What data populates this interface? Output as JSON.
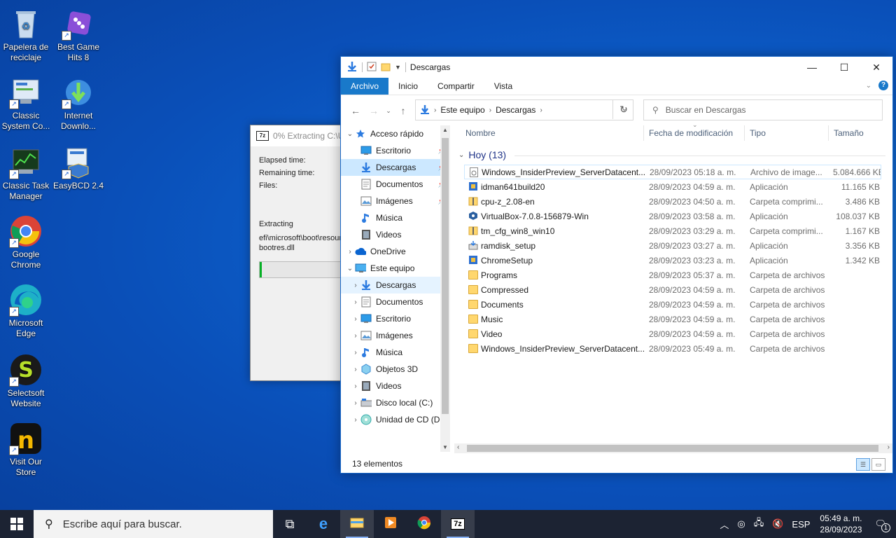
{
  "desktop": {
    "icons": [
      {
        "label": "Papelera de reciclaje",
        "icon": "recycle-bin-icon"
      },
      {
        "label": "Best Game Hits 8",
        "icon": "dice-icon"
      },
      {
        "label": "Classic System Co...",
        "icon": "control-panel-icon"
      },
      {
        "label": "Internet Downlo...",
        "icon": "idm-icon"
      },
      {
        "label": "Classic Task Manager",
        "icon": "task-manager-icon"
      },
      {
        "label": "EasyBCD 2.4",
        "icon": "easybcd-icon"
      },
      {
        "label": "Google Chrome",
        "icon": "chrome-icon"
      },
      {
        "label": "Microsoft Edge",
        "icon": "edge-icon"
      },
      {
        "label": "Selectsoft Website",
        "icon": "selectsoft-icon"
      },
      {
        "label": "Visit Our Store",
        "icon": "store-icon"
      }
    ]
  },
  "zip_dialog": {
    "title": "0% Extracting C:\\U",
    "elapsed_label": "Elapsed time:",
    "remaining_label": "Remaining time:",
    "files_label": "Files:",
    "extracting_label": "Extracting",
    "path_line": "efi\\microsoft\\boot\\resour",
    "file_line": "bootres.dll",
    "progress": 0.02
  },
  "explorer": {
    "title": "Descargas",
    "ribbon_tabs": [
      "Archivo",
      "Inicio",
      "Compartir",
      "Vista"
    ],
    "address": [
      "Este equipo",
      "Descargas"
    ],
    "search_placeholder": "Buscar en Descargas",
    "nav": [
      {
        "label": "Acceso rápido",
        "level": 0,
        "expanded": true
      },
      {
        "label": "Escritorio",
        "level": 1,
        "pinned": true
      },
      {
        "label": "Descargas",
        "level": 1,
        "pinned": true,
        "selected": true
      },
      {
        "label": "Documentos",
        "level": 1,
        "pinned": true
      },
      {
        "label": "Imágenes",
        "level": 1,
        "pinned": true
      },
      {
        "label": "Música",
        "level": 1
      },
      {
        "label": "Videos",
        "level": 1
      },
      {
        "label": "OneDrive",
        "level": 0
      },
      {
        "label": "Este equipo",
        "level": 0,
        "expanded": true
      },
      {
        "label": "Descargas",
        "level": 1,
        "hover": true
      },
      {
        "label": "Documentos",
        "level": 1
      },
      {
        "label": "Escritorio",
        "level": 1
      },
      {
        "label": "Imágenes",
        "level": 1
      },
      {
        "label": "Música",
        "level": 1
      },
      {
        "label": "Objetos 3D",
        "level": 1
      },
      {
        "label": "Videos",
        "level": 1
      },
      {
        "label": "Disco local (C:)",
        "level": 1
      },
      {
        "label": "Unidad de CD (D",
        "level": 1
      }
    ],
    "columns": {
      "name": "Nombre",
      "date": "Fecha de modificación",
      "type": "Tipo",
      "size": "Tamaño"
    },
    "group_label": "Hoy (13)",
    "files": [
      {
        "name": "Windows_InsiderPreview_ServerDatacent...",
        "date": "28/09/2023 05:18 a. m.",
        "type": "Archivo de image...",
        "size": "5.084.666 KB",
        "icon": "disc-image-icon",
        "selected": true
      },
      {
        "name": "idman641build20",
        "date": "28/09/2023 04:59 a. m.",
        "type": "Aplicación",
        "size": "11.165 KB",
        "icon": "app-icon"
      },
      {
        "name": "cpu-z_2.08-en",
        "date": "28/09/2023 04:50 a. m.",
        "type": "Carpeta comprimi...",
        "size": "3.486 KB",
        "icon": "zip-folder-icon"
      },
      {
        "name": "VirtualBox-7.0.8-156879-Win",
        "date": "28/09/2023 03:58 a. m.",
        "type": "Aplicación",
        "size": "108.037 KB",
        "icon": "virtualbox-icon"
      },
      {
        "name": "tm_cfg_win8_win10",
        "date": "28/09/2023 03:29 a. m.",
        "type": "Carpeta comprimi...",
        "size": "1.167 KB",
        "icon": "zip-folder-icon"
      },
      {
        "name": "ramdisk_setup",
        "date": "28/09/2023 03:27 a. m.",
        "type": "Aplicación",
        "size": "3.356 KB",
        "icon": "installer-icon"
      },
      {
        "name": "ChromeSetup",
        "date": "28/09/2023 03:23 a. m.",
        "type": "Aplicación",
        "size": "1.342 KB",
        "icon": "app-icon"
      },
      {
        "name": "Programs",
        "date": "28/09/2023 05:37 a. m.",
        "type": "Carpeta de archivos",
        "size": "",
        "icon": "folder-icon"
      },
      {
        "name": "Compressed",
        "date": "28/09/2023 04:59 a. m.",
        "type": "Carpeta de archivos",
        "size": "",
        "icon": "folder-icon"
      },
      {
        "name": "Documents",
        "date": "28/09/2023 04:59 a. m.",
        "type": "Carpeta de archivos",
        "size": "",
        "icon": "folder-icon"
      },
      {
        "name": "Music",
        "date": "28/09/2023 04:59 a. m.",
        "type": "Carpeta de archivos",
        "size": "",
        "icon": "folder-icon"
      },
      {
        "name": "Video",
        "date": "28/09/2023 04:59 a. m.",
        "type": "Carpeta de archivos",
        "size": "",
        "icon": "folder-icon"
      },
      {
        "name": "Windows_InsiderPreview_ServerDatacent...",
        "date": "28/09/2023 05:49 a. m.",
        "type": "Carpeta de archivos",
        "size": "",
        "icon": "folder-icon"
      }
    ],
    "status": "13 elementos"
  },
  "taskbar": {
    "search_placeholder": "Escribe aquí para buscar.",
    "language": "ESP",
    "time": "05:49 a. m.",
    "date": "28/09/2023",
    "notifications": "1"
  },
  "colors": {
    "accent": "#1979ca",
    "desktop": "#0c5ec9",
    "taskbar": "#1c2333",
    "selection": "#cce8ff"
  }
}
